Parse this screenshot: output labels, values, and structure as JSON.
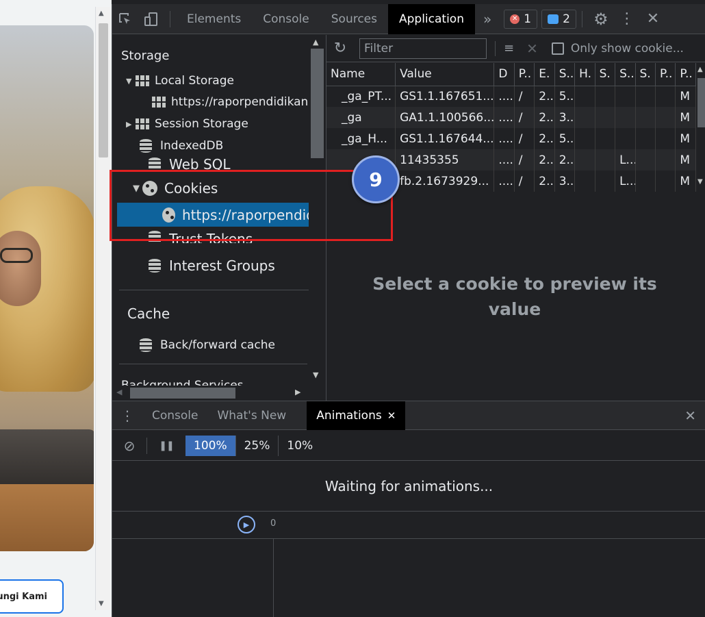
{
  "webpage": {
    "contact_button": "ungi Kami"
  },
  "devtools": {
    "tabs": [
      "Elements",
      "Console",
      "Sources",
      "Application"
    ],
    "active_tab": "Application",
    "more_tabs": "»",
    "error_count": "1",
    "message_count": "2",
    "sidebar": {
      "storage_heading": "Storage",
      "local_storage": "Local Storage",
      "local_storage_url": "https://raporpendidikan.",
      "session_storage": "Session Storage",
      "indexeddb": "IndexedDB",
      "web_sql": "Web SQL",
      "cookies": "Cookies",
      "cookies_url": "https://raporpendidikan.",
      "trust_tokens": "Trust Tokens",
      "interest_groups": "Interest Groups",
      "cache_heading": "Cache",
      "back_forward_cache": "Back/forward cache",
      "background_services": "Background Services"
    },
    "cookie_toolbar": {
      "filter_placeholder": "Filter",
      "only_show_label": "Only show cookie..."
    },
    "cookie_table": {
      "headers": [
        "Name",
        "Value",
        "D",
        "P..",
        "E.",
        "S..",
        "H.",
        "S.",
        "S..",
        "S.",
        "P..",
        "P.."
      ],
      "rows": [
        [
          "_ga_PT...",
          "GS1.1.167651...",
          "....",
          "/",
          "2...",
          "5...",
          "",
          "",
          "",
          "",
          "",
          "M"
        ],
        [
          "_ga",
          "GA1.1.100566...",
          "....",
          "/",
          "2...",
          "3...",
          "",
          "",
          "",
          "",
          "",
          "M"
        ],
        [
          "_ga_H...",
          "GS1.1.167644...",
          "....",
          "/",
          "2...",
          "5...",
          "",
          "",
          "",
          "",
          "",
          "M"
        ],
        [
          "",
          "11435355",
          "....",
          "/",
          "2...",
          "2...",
          "",
          "",
          "L...",
          "",
          "",
          "M"
        ],
        [
          "",
          "fb.2.1673929...",
          "....",
          "/",
          "2...",
          "3...",
          "",
          "",
          "L...",
          "",
          "",
          "M"
        ]
      ]
    },
    "preview_text": "Select a cookie to preview its value",
    "drawer": {
      "tabs": [
        "Console",
        "What's New",
        "Animations"
      ],
      "active_tab": "Animations",
      "speeds": [
        "100%",
        "25%",
        "10%"
      ],
      "active_speed": "100%",
      "waiting_text": "Waiting for animations...",
      "timeline_zero": "0"
    }
  },
  "annotation": {
    "step_number": "9",
    "highlight_color": "#e02020",
    "badge_color": "#3d66c4"
  }
}
